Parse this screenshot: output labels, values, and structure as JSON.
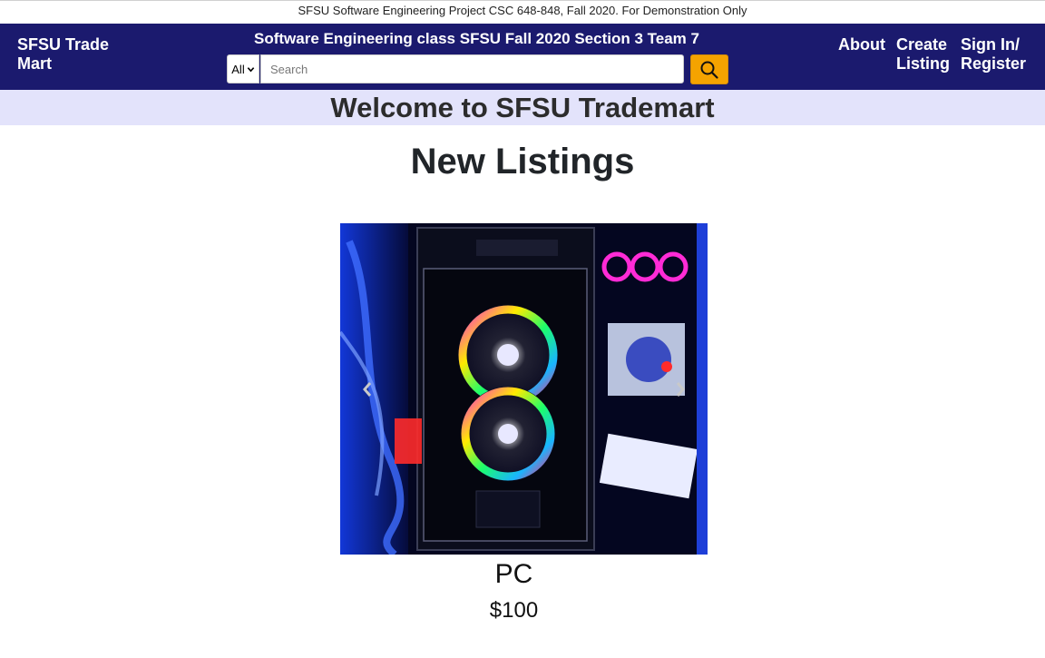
{
  "notice": "SFSU Software Engineering Project CSC 648-848, Fall 2020. For Demonstration Only",
  "navbar": {
    "brand": "SFSU Trade\nMart",
    "title": "Software Engineering class SFSU Fall 2020 Section 3 Team 7",
    "category_selected": "All",
    "search_placeholder": "Search",
    "links": {
      "about": "About",
      "create_listing": "Create\nListing",
      "sign_in": "Sign In/\nRegister"
    },
    "colors": {
      "background": "#1b1a6e",
      "search_button": "#f5a300"
    }
  },
  "welcome": "Welcome to SFSU Trademart",
  "section_heading": "New Listings",
  "carousel": {
    "image_subject": "gaming PC case with RGB fans",
    "prev_icon": "chevron-left-icon",
    "next_icon": "chevron-right-icon"
  },
  "listing": {
    "name": "PC",
    "price": "$100"
  }
}
